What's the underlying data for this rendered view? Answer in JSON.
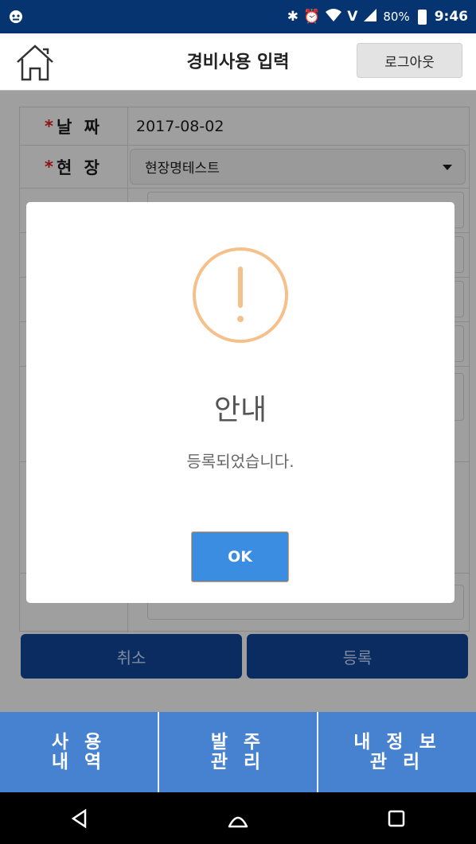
{
  "status_bar": {
    "battery": "80%",
    "time": "9:46",
    "network": "V",
    "icons": [
      "bluetooth-icon",
      "alarm-icon",
      "wifi-icon",
      "signal-icon",
      "battery-icon"
    ]
  },
  "header": {
    "title": "경비사용 입력",
    "logout_label": "로그아웃"
  },
  "form": {
    "date_label": "날 짜",
    "date_value": "2017-08-02",
    "site_label": "현 장",
    "site_value": "현장명테스트",
    "required_mark": "*",
    "cancel_label": "취소",
    "submit_label": "등록"
  },
  "dialog": {
    "title": "안내",
    "message": "등록되었습니다.",
    "ok_label": "OK",
    "accent_color": "#f5c08a",
    "button_color": "#3a8de0"
  },
  "bottom_nav": {
    "items": [
      {
        "line1": "사 용",
        "line2": "내 역"
      },
      {
        "line1": "발 주",
        "line2": "관 리"
      },
      {
        "line1": "내 정 보",
        "line2": "관 리"
      }
    ]
  },
  "colors": {
    "status_bar": "#063470",
    "nav": "#4782d0",
    "action_button": "#0a2c61"
  }
}
